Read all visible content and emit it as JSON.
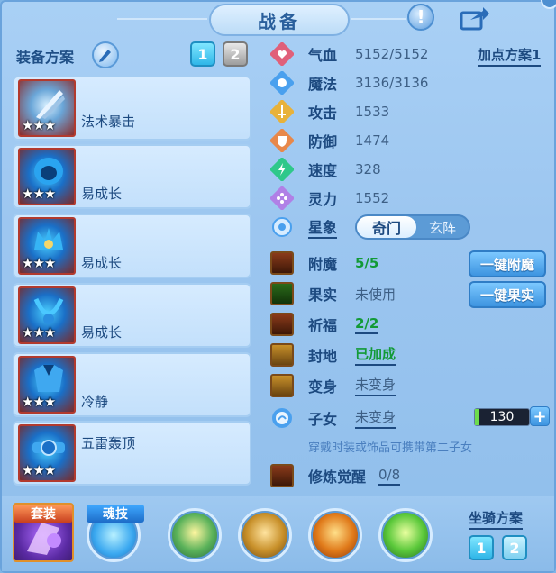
{
  "window": {
    "title": "战备"
  },
  "left": {
    "plan_label": "装备方案",
    "plan_buttons": [
      "1",
      "2"
    ],
    "items": [
      {
        "name": "法术暴击",
        "stars": "★★★",
        "icon": "staff-icon"
      },
      {
        "name": "易成长",
        "stars": "★★★",
        "icon": "helmet-icon"
      },
      {
        "name": "易成长",
        "stars": "★★★",
        "icon": "crown-icon"
      },
      {
        "name": "易成长",
        "stars": "★★★",
        "icon": "necklace-icon"
      },
      {
        "name": "冷静",
        "stars": "★★★",
        "icon": "armor-icon"
      },
      {
        "name": "五雷轰顶",
        "stars": "★★★",
        "icon": "belt-icon"
      }
    ]
  },
  "stats": {
    "add_point_label": "加点方案1",
    "rows": [
      {
        "label": "气血",
        "value": "5152/5152",
        "icon": "heart-icon",
        "color": "#e0607a"
      },
      {
        "label": "魔法",
        "value": "3136/3136",
        "icon": "mana-icon",
        "color": "#4aa0ee"
      },
      {
        "label": "攻击",
        "value": "1533",
        "icon": "sword-icon",
        "color": "#e8b23a"
      },
      {
        "label": "防御",
        "value": "1474",
        "icon": "shield-icon",
        "color": "#e8884a"
      },
      {
        "label": "速度",
        "value": "328",
        "icon": "lightning-icon",
        "color": "#2fc88a"
      },
      {
        "label": "灵力",
        "value": "1552",
        "icon": "spirit-icon",
        "color": "#b080e6"
      }
    ],
    "star_label": "星象",
    "star_toggle": {
      "on": "奇门",
      "off": "玄阵"
    }
  },
  "features": {
    "enchant": {
      "label": "附魔",
      "value": "5/5"
    },
    "fruit": {
      "label": "果实",
      "value": "未使用"
    },
    "bless": {
      "label": "祈福",
      "value": "2/2"
    },
    "seal": {
      "label": "封地",
      "value": "已加成"
    },
    "transform": {
      "label": "变身",
      "value": "未变身"
    },
    "child": {
      "label": "子女",
      "value": "未变身",
      "bar_value": "130"
    },
    "awaken": {
      "label": "修炼觉醒",
      "value": "0/8"
    },
    "tip": "穿戴时装或饰品可携带第二子女",
    "btn_enchant": "一键附魔",
    "btn_fruit": "一键果实"
  },
  "bottom": {
    "suit_label": "套装",
    "soul_label": "魂技",
    "mount_label": "坐骑方案",
    "mount_buttons": [
      "1",
      "2"
    ]
  }
}
